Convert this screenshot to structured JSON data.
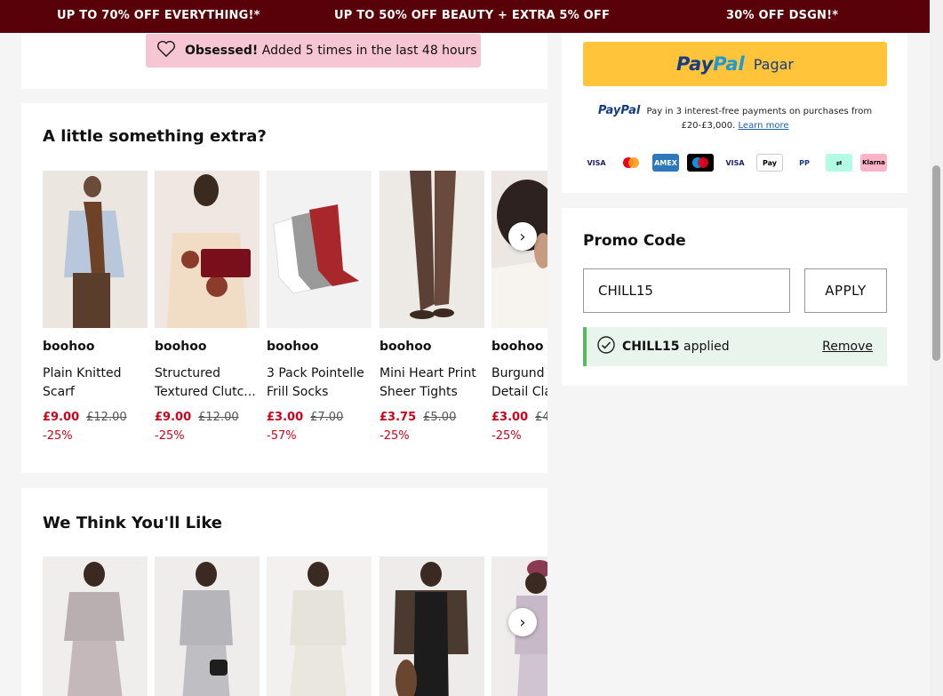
{
  "promo_bar": {
    "offer_1": "UP TO 70% OFF EVERYTHING!*",
    "offer_2": "UP TO 50% OFF BEAUTY + EXTRA 5% OFF",
    "offer_3": "30% OFF DSGN!*"
  },
  "obsessed": {
    "label": "Obsessed!",
    "text": "Added 5 times in the last 48 hours"
  },
  "extra_section": {
    "title": "A little something extra?",
    "products": [
      {
        "brand": "boohoo",
        "name1": "Plain Knitted",
        "name2": "Scarf",
        "price": "£9.00",
        "was": "£12.00",
        "discount": "-25%"
      },
      {
        "brand": "boohoo",
        "name1": "Structured",
        "name2": "Textured Clutc...",
        "price": "£9.00",
        "was": "£12.00",
        "discount": "-25%"
      },
      {
        "brand": "boohoo",
        "name1": "3 Pack Pointelle",
        "name2": "Frill Socks",
        "price": "£3.00",
        "was": "£7.00",
        "discount": "-57%"
      },
      {
        "brand": "boohoo",
        "name1": "Mini Heart Print",
        "name2": "Sheer Tights",
        "price": "£3.75",
        "was": "£5.00",
        "discount": "-25%"
      },
      {
        "brand": "boohoo",
        "name1": "Burgund",
        "name2": "Detail Cla",
        "price": "£3.00",
        "was": "£4",
        "discount": "-25%"
      }
    ]
  },
  "like_section": {
    "title": "We Think You'll Like"
  },
  "payment": {
    "paypal_pay": "Pay",
    "paypal_pal": "Pal",
    "paypal_button_label": "Pagar",
    "small_paypal": "PayPal",
    "pay_in_text": "Pay in 3 interest-free payments on purchases from £20-£3,000.",
    "learn_more": "Learn more",
    "methods": [
      "VISA",
      "MC",
      "AMEX",
      "Maestro",
      "VISA",
      "Pay",
      "PP",
      "clearpay",
      "Klarna"
    ]
  },
  "promo": {
    "title": "Promo Code",
    "code_value": "CHILL15",
    "apply_label": "APPLY",
    "applied_code": "CHILL15",
    "applied_text": "applied",
    "remove_label": "Remove"
  },
  "colors": {
    "promo_bar": "#580108",
    "sale_red": "#d0021b",
    "paypal_yellow": "#ffc43a",
    "paypal_blue": "#153c84"
  }
}
